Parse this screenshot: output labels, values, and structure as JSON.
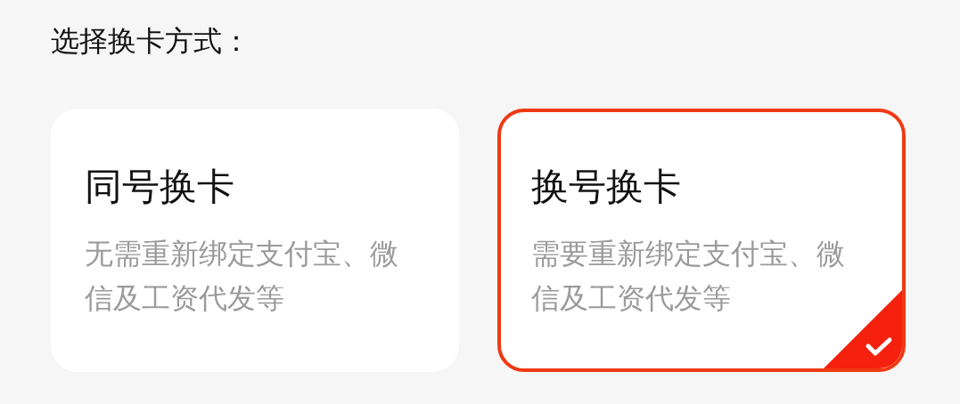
{
  "heading": "选择换卡方式：",
  "options": [
    {
      "title": "同号换卡",
      "description": "无需重新绑定支付宝、微信及工资代发等",
      "selected": false
    },
    {
      "title": "换号换卡",
      "description": "需要重新绑定支付宝、微信及工资代发等",
      "selected": true
    }
  ]
}
